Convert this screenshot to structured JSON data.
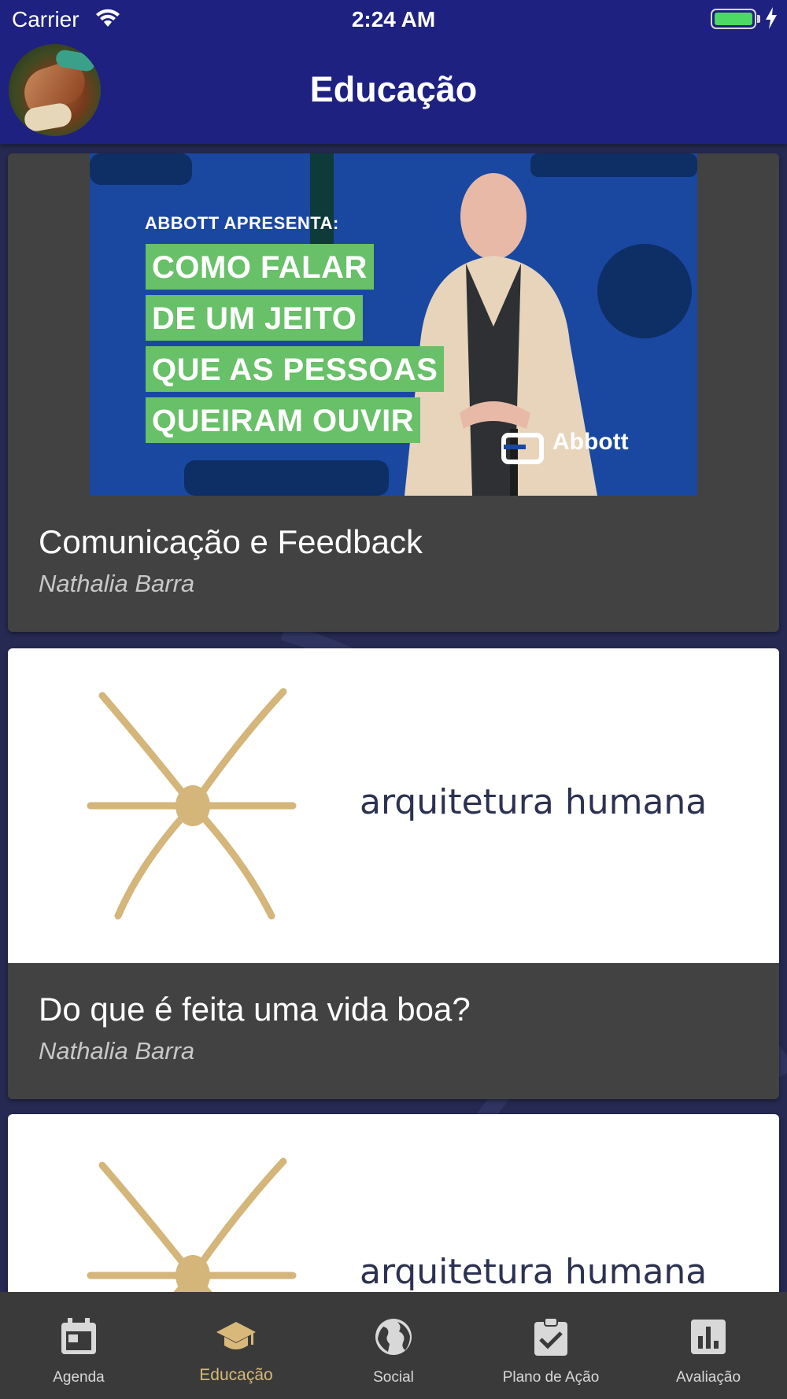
{
  "status_bar": {
    "carrier": "Carrier",
    "time": "2:24 AM"
  },
  "header": {
    "title": "Educação"
  },
  "cards": [
    {
      "title": "Comunicação e Feedback",
      "author": "Nathalia Barra",
      "media": {
        "type": "video-thumbnail",
        "kicker": "ABBOTT APRESENTA:",
        "lines": [
          "COMO FALAR",
          "DE UM JEITO",
          "QUE AS PESSOAS",
          "QUEIRAM OUVIR"
        ],
        "brand": "Abbott"
      }
    },
    {
      "title": "Do que é feita uma vida boa?",
      "author": "Nathalia Barra",
      "media": {
        "type": "logo",
        "text": "arquitetura humana"
      }
    },
    {
      "media": {
        "type": "logo",
        "text": "arquitetura humana"
      }
    }
  ],
  "bottom_nav": [
    {
      "label": "Agenda",
      "icon": "calendar-icon",
      "active": false
    },
    {
      "label": "Educação",
      "icon": "graduation-cap-icon",
      "active": true
    },
    {
      "label": "Social",
      "icon": "globe-icon",
      "active": false
    },
    {
      "label": "Plano de Ação",
      "icon": "clipboard-check-icon",
      "active": false
    },
    {
      "label": "Avaliação",
      "icon": "bar-chart-icon",
      "active": false
    }
  ],
  "colors": {
    "header": "#1e2180",
    "background": "#262a52",
    "card": "#424242",
    "nav_active": "#d8b979",
    "thumb_green": "#68c068",
    "logo_gold": "#d4b57a"
  }
}
